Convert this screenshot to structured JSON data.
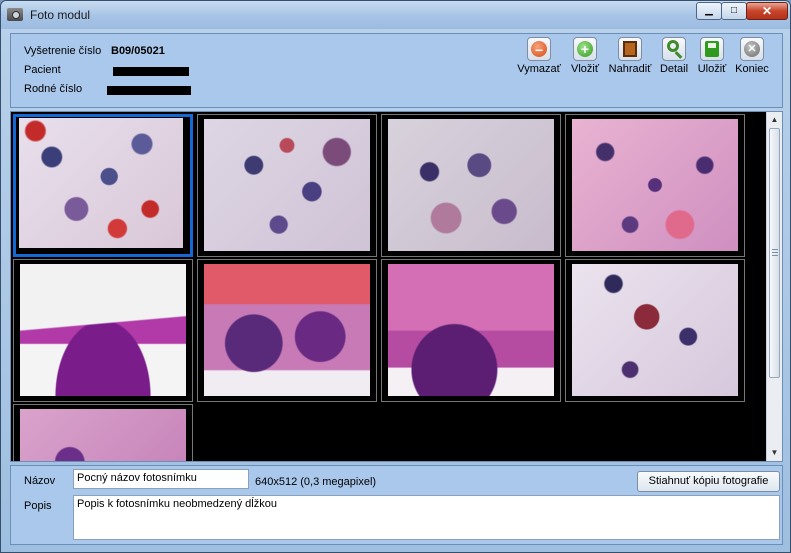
{
  "window": {
    "title": "Foto modul",
    "controls": {
      "minimize": "▁",
      "maximize": "□",
      "close": "✕"
    }
  },
  "header": {
    "exam_label": "Vyšetrenie číslo",
    "exam_value": "B09/05021",
    "patient_label": "Pacient",
    "birth_label": "Rodné číslo"
  },
  "toolbar": {
    "items": [
      {
        "label": "Vymazať",
        "icon": "delete-icon"
      },
      {
        "label": "Vložiť",
        "icon": "add-icon"
      },
      {
        "label": "Nahradiť",
        "icon": "film-icon"
      },
      {
        "label": "Detail",
        "icon": "magnifier-icon"
      },
      {
        "label": "Uložiť",
        "icon": "save-icon"
      },
      {
        "label": "Koniec",
        "icon": "exit-icon"
      }
    ]
  },
  "gallery": {
    "thumbnails": [
      {
        "kind": "cytology",
        "selected": true
      },
      {
        "kind": "cytology",
        "selected": false
      },
      {
        "kind": "cytology",
        "selected": false
      },
      {
        "kind": "cytology",
        "selected": false
      },
      {
        "kind": "histology",
        "selected": false
      },
      {
        "kind": "histology",
        "selected": false
      },
      {
        "kind": "histology",
        "selected": false
      },
      {
        "kind": "cytology",
        "selected": false
      },
      {
        "kind": "histology",
        "selected": false
      }
    ]
  },
  "details": {
    "name_label": "Názov",
    "name_value": "Pocný názov fotosnímku",
    "resolution": "640x512 (0,3 megapixel)",
    "download_button": "Stiahnuť kópiu fotografie",
    "desc_label": "Popis",
    "desc_value": "Popis k fotosnímku neobmedzený dĺžkou"
  }
}
